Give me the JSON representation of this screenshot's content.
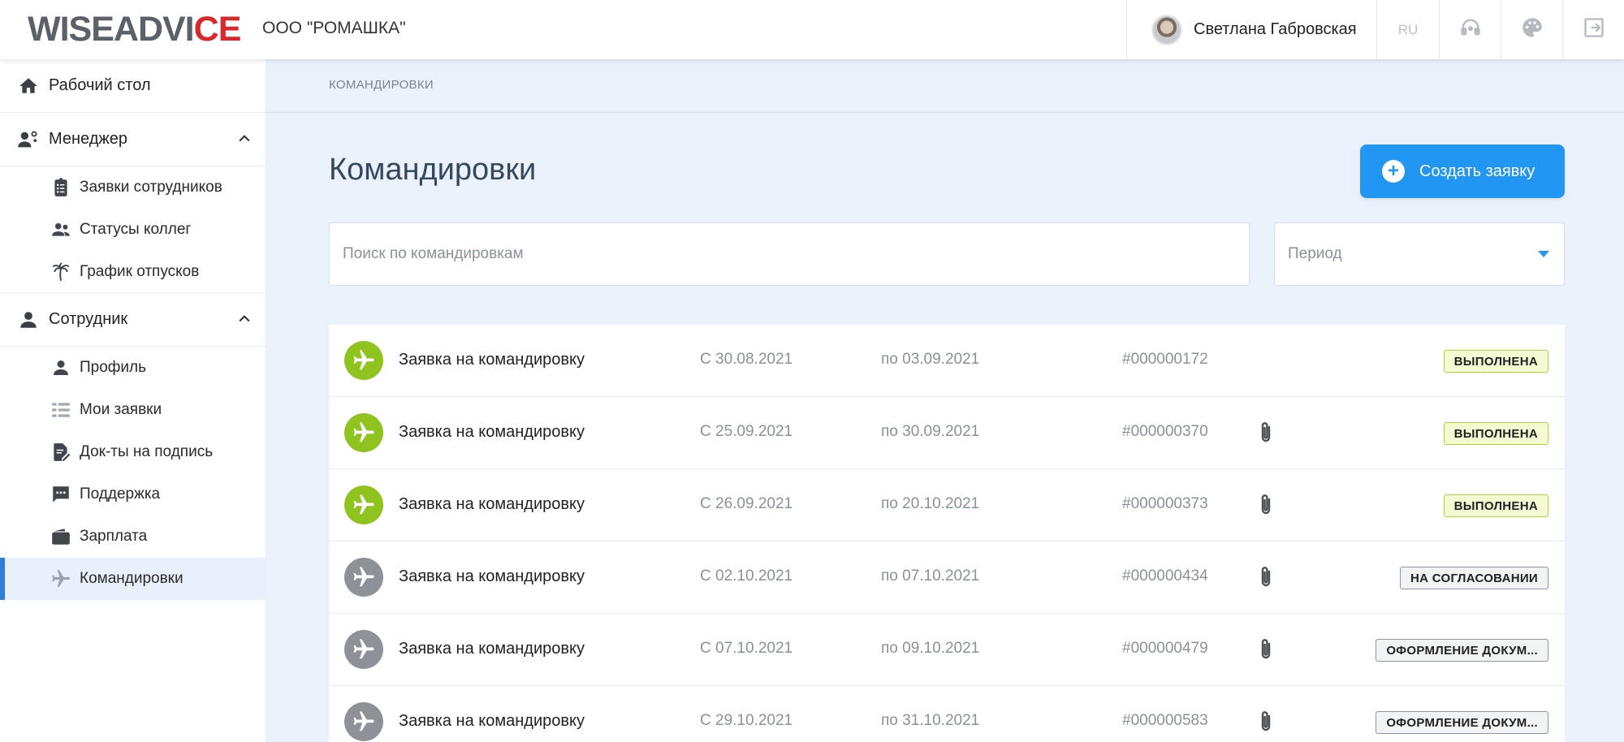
{
  "header": {
    "logo_part1": "WISEADVI",
    "logo_part2": "CE",
    "company": "ООО \"РОМАШКА\"",
    "user_name": "Светлана Габровская",
    "lang": "RU"
  },
  "sidebar": {
    "desktop": "Рабочий стол",
    "manager": {
      "label": "Менеджер",
      "items": [
        "Заявки сотрудников",
        "Статусы коллег",
        "График отпусков"
      ]
    },
    "employee": {
      "label": "Сотрудник",
      "items": [
        "Профиль",
        "Мои заявки",
        "Док-ты на подпись",
        "Поддержка",
        "Зарплата",
        "Командировки"
      ]
    },
    "active": "Командировки"
  },
  "breadcrumb": "КОМАНДИРОВКИ",
  "page_title": "Командировки",
  "create_button": "Создать заявку",
  "search": {
    "placeholder": "Поиск по командировкам",
    "value": ""
  },
  "period": {
    "placeholder": "Период"
  },
  "colors": {
    "accent": "#2196f3",
    "done_icon": "#8fc31f",
    "pending_icon": "#8d9298"
  },
  "requests": [
    {
      "title": "Заявка на командировку",
      "from": "С 30.08.2021",
      "to": "по 03.09.2021",
      "number": "#000000172",
      "attachment": false,
      "status": "ВЫПОЛНЕНА",
      "state": "done"
    },
    {
      "title": "Заявка на командировку",
      "from": "С 25.09.2021",
      "to": "по 30.09.2021",
      "number": "#000000370",
      "attachment": true,
      "status": "ВЫПОЛНЕНА",
      "state": "done"
    },
    {
      "title": "Заявка на командировку",
      "from": "С 26.09.2021",
      "to": "по 20.10.2021",
      "number": "#000000373",
      "attachment": true,
      "status": "ВЫПОЛНЕНА",
      "state": "done"
    },
    {
      "title": "Заявка на командировку",
      "from": "С 02.10.2021",
      "to": "по 07.10.2021",
      "number": "#000000434",
      "attachment": true,
      "status": "НА СОГЛАСОВАНИИ",
      "state": "pending"
    },
    {
      "title": "Заявка на командировку",
      "from": "С 07.10.2021",
      "to": "по 09.10.2021",
      "number": "#000000479",
      "attachment": true,
      "status": "ОФОРМЛЕНИЕ ДОКУМ...",
      "state": "pending"
    },
    {
      "title": "Заявка на командировку",
      "from": "С 29.10.2021",
      "to": "по 31.10.2021",
      "number": "#000000583",
      "attachment": true,
      "status": "ОФОРМЛЕНИЕ ДОКУМ...",
      "state": "pending"
    }
  ]
}
